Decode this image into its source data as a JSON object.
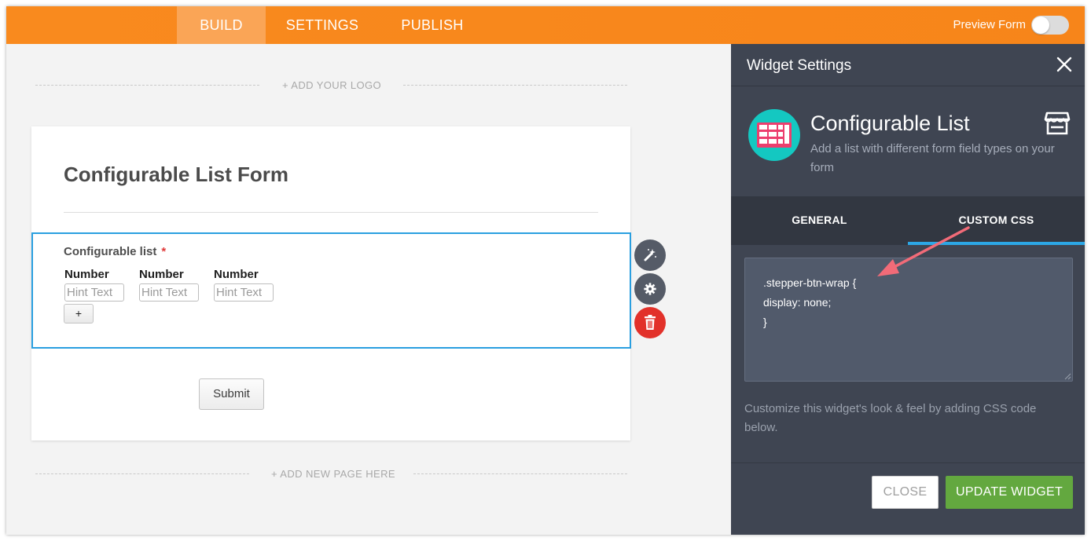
{
  "topbar": {
    "tabs": [
      {
        "label": "BUILD",
        "active": true
      },
      {
        "label": "SETTINGS",
        "active": false
      },
      {
        "label": "PUBLISH",
        "active": false
      }
    ],
    "preview_label": "Preview Form",
    "preview_on": false
  },
  "canvas": {
    "add_logo": "+ ADD YOUR LOGO",
    "add_page": "+ ADD NEW PAGE HERE"
  },
  "form": {
    "title": "Configurable List Form",
    "field": {
      "label": "Configurable list",
      "required_mark": "*",
      "columns": [
        {
          "header": "Number",
          "placeholder": "Hint Text"
        },
        {
          "header": "Number",
          "placeholder": "Hint Text"
        },
        {
          "header": "Number",
          "placeholder": "Hint Text"
        }
      ],
      "add_row_label": "+"
    },
    "submit_label": "Submit"
  },
  "field_tools": [
    "wand-icon",
    "gear-icon",
    "trash-icon"
  ],
  "panel": {
    "title": "Widget Settings",
    "widget": {
      "name": "Configurable List",
      "description": "Add a list with different form field types on your form"
    },
    "tabs": [
      {
        "label": "GENERAL",
        "active": false
      },
      {
        "label": "CUSTOM CSS",
        "active": true
      }
    ],
    "css_code": ".stepper-btn-wrap {\ndisplay: none;\n}",
    "help_text": "Customize this widget's look & feel by adding CSS code below.",
    "close_label": "CLOSE",
    "update_label": "UPDATE WIDGET"
  },
  "colors": {
    "topbar": "#f98a1e",
    "active_tab": "#faa556",
    "panel_bg": "#3f4552",
    "accent_blue": "#2ca7e6",
    "update_green": "#63a83f",
    "delete_red": "#e2312a",
    "widget_teal": "#14c8c1",
    "annotation_arrow": "#f26b78"
  }
}
